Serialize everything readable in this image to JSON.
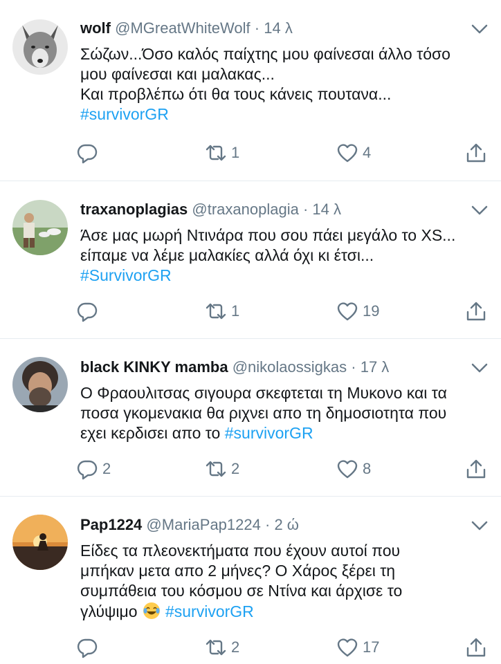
{
  "tweets": [
    {
      "name": "wolf",
      "handle": "@MGreatWhiteWolf",
      "dot": "·",
      "time": "14 λ",
      "lines": [
        "Σώζων...Όσο καλός παίχτης μου φαίνεσαι άλλο τόσο",
        "μου φαίνεσαι και μαλακας...",
        "Και προβλέπω ότι θα τους κάνεις πουτανα..."
      ],
      "hashtag": "#survivorGR",
      "replies": "",
      "retweets": "1",
      "likes": "4"
    },
    {
      "name": "traxanoplagias",
      "handle": "@traxanoplagia",
      "dot": "·",
      "time": "14 λ",
      "lines": [
        "Άσε μας μωρή Ντινάρα που σου πάει μεγάλο το XS...",
        "είπαμε να λέμε μαλακίες αλλά όχι κι έτσι..."
      ],
      "hashtag": "#SurvivorGR",
      "replies": "",
      "retweets": "1",
      "likes": "19"
    },
    {
      "name": "black KINKY mamba",
      "handle": "@nikolaossigkas",
      "dot": "·",
      "time": "17 λ",
      "lines": [
        "Ο Φραουλιτσας σιγουρα σκεφτεται τη Μυκονο και τα",
        "ποσα γκομενακια θα ριχνει απο τη δημοσιοτητα που"
      ],
      "last_line_text": "εχει κερδισει απο το ",
      "hashtag": "#survivorGR",
      "replies": "2",
      "retweets": "2",
      "likes": "8"
    },
    {
      "name": "Pap1224",
      "handle": "@MariaPap1224",
      "dot": "·",
      "time": "2 ώ",
      "lines": [
        "Είδες τα πλεονεκτήματα που έχουν αυτοί που",
        "μπήκαν μετα απο 2 μήνες? Ο Χάρος ξέρει τη",
        "συμπάθεια του κόσμου σε Ντίνα και άρχισε το"
      ],
      "last_line_text": "γλύψιμο ",
      "hashtag": "#survivorGR",
      "replies": "",
      "retweets": "2",
      "likes": "17"
    }
  ],
  "colors": {
    "text": "#14171a",
    "secondary": "#657786",
    "link": "#1da1f2",
    "divider": "#e6ecf0"
  },
  "icons": [
    "chevron-down-icon",
    "reply-icon",
    "retweet-icon",
    "like-icon",
    "share-icon",
    "laughing-emoji-icon"
  ]
}
